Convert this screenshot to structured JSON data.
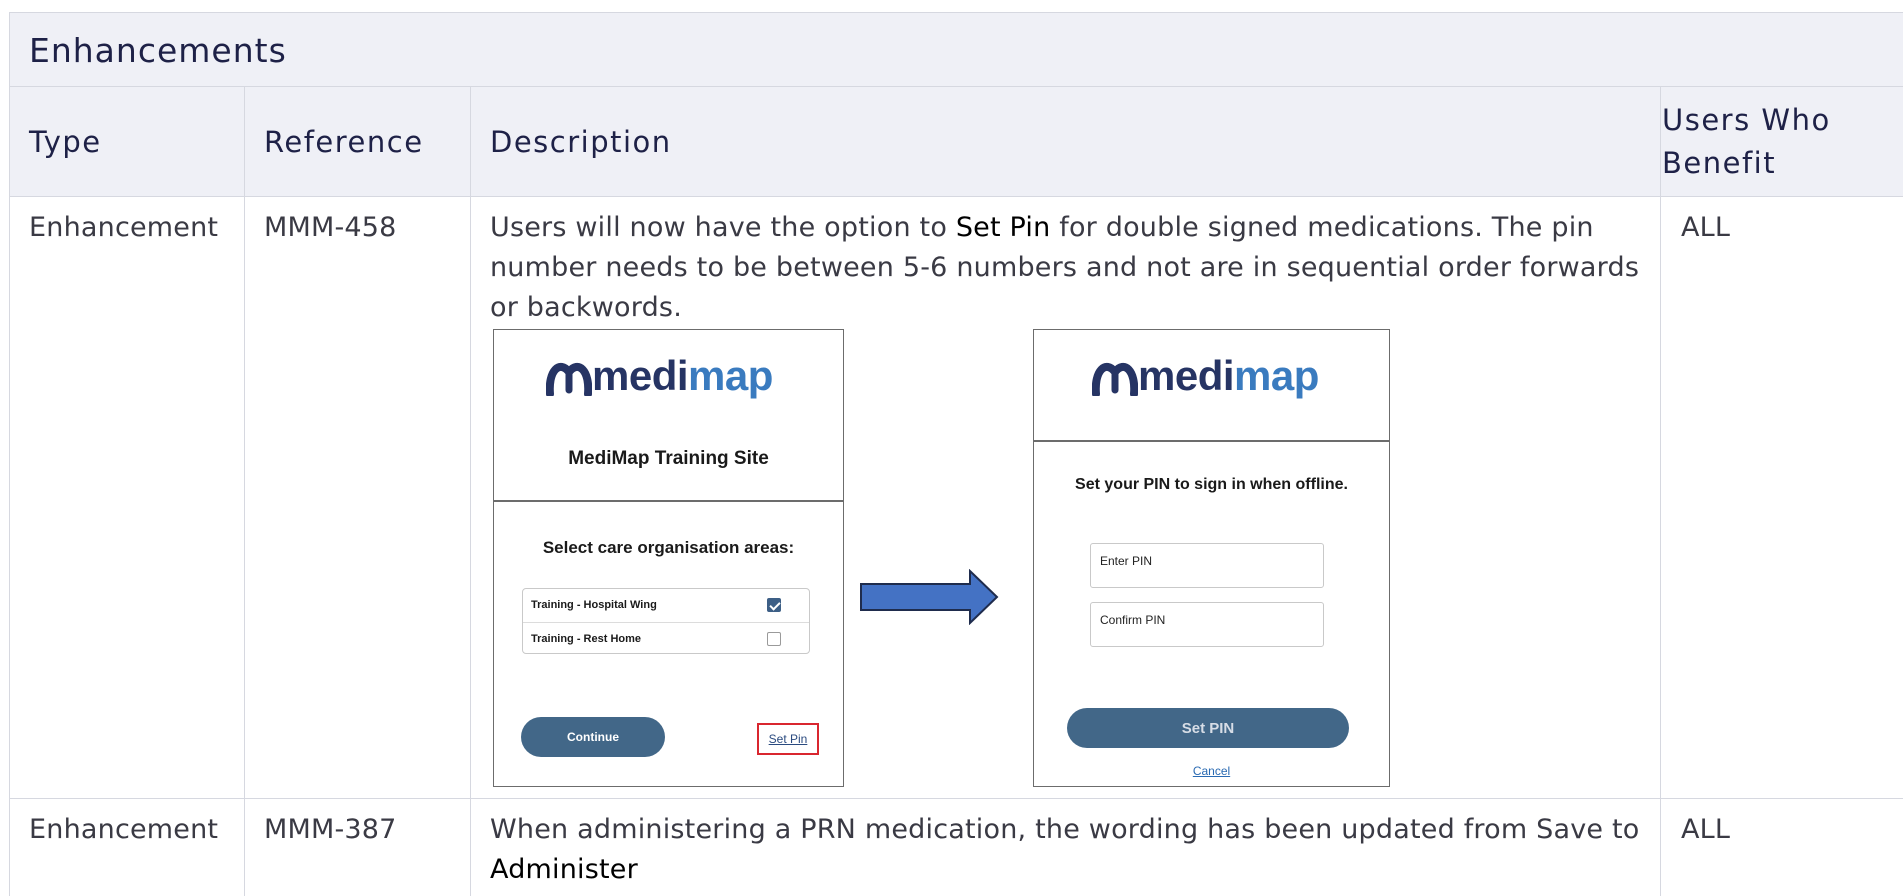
{
  "section_title": "Enhancements",
  "columns": [
    "Type",
    "Reference",
    "Description",
    "Users Who Benefit"
  ],
  "rows": [
    {
      "type": "Enhancement",
      "reference": "MMM-458",
      "desc_pre": "Users will now have the option to ",
      "desc_bold": "Set Pin",
      "desc_post": " for double signed medications. The pin number needs to be between 5-6 numbers and not are in sequential order forwards or backwords.",
      "users": "ALL"
    },
    {
      "type": "Enhancement",
      "reference": "MMM-387",
      "desc_pre": "When administering a PRN medication, the wording has been updated from Save to ",
      "desc_bold": "Administer",
      "desc_post": "",
      "users": "ALL"
    }
  ],
  "screenshot_left": {
    "logo_a": "medi",
    "logo_b": "map",
    "site_title": "MediMap Training Site",
    "prompt": "Select care organisation areas:",
    "options": [
      {
        "label": "Training - Hospital Wing",
        "checked": true
      },
      {
        "label": "Training - Rest Home",
        "checked": false
      }
    ],
    "continue_label": "Continue",
    "set_pin_link": "Set Pin"
  },
  "screenshot_right": {
    "logo_a": "medi",
    "logo_b": "map",
    "prompt": "Set your PIN to sign in when offline.",
    "enter_pin": "Enter PIN",
    "confirm_pin": "Confirm PIN",
    "set_pin_button": "Set PIN",
    "cancel_link": "Cancel"
  },
  "colors": {
    "header_bg": "#eff0f6",
    "header_text": "#1e2147",
    "arrow_fill": "#4472c4",
    "logo_dark": "#263464",
    "logo_light": "#3a7bbf",
    "button_bg": "#426788",
    "highlight_border": "#d9262f"
  }
}
